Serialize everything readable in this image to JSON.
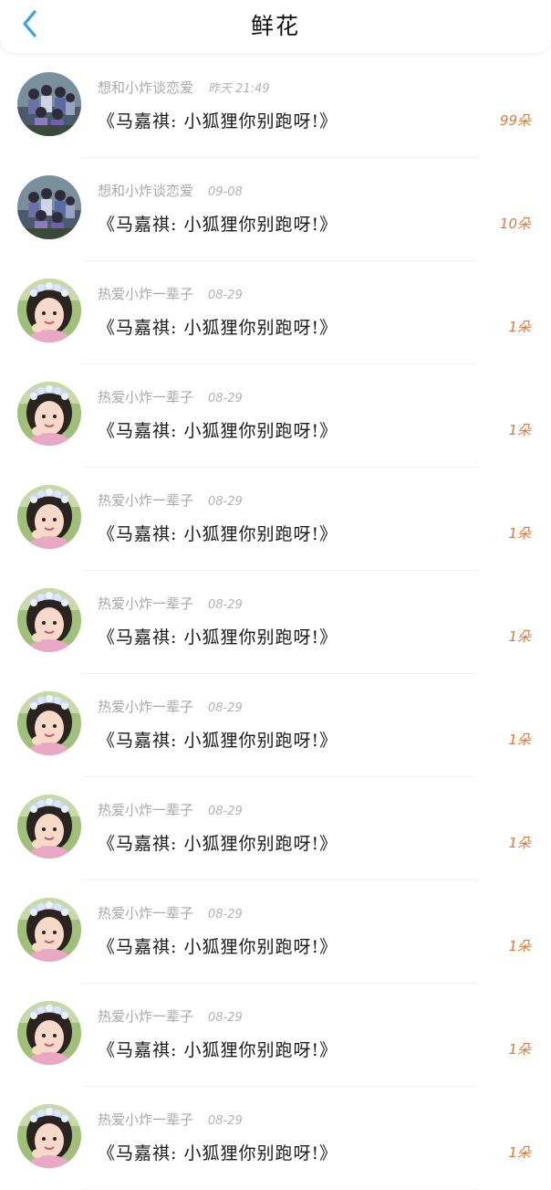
{
  "header": {
    "title": "鲜花",
    "back_icon": "chevron-left-icon",
    "accent_color": "#3aa0e8"
  },
  "colors": {
    "count": "#e07a3a",
    "meta": "#a9a9a9"
  },
  "rows": [
    {
      "username": "想和小炸谈恋爱",
      "time": "昨天 21:49",
      "message": "《马嘉祺: 小狐狸你别跑呀!》",
      "count": "99朵",
      "avatar": "group-photo-avatar"
    },
    {
      "username": "想和小炸谈恋爱",
      "time": "09-08",
      "message": "《马嘉祺: 小狐狸你别跑呀!》",
      "count": "10朵",
      "avatar": "group-photo-avatar"
    },
    {
      "username": "热爱小炸一辈子",
      "time": "08-29",
      "message": "《马嘉祺: 小狐狸你别跑呀!》",
      "count": "1朵",
      "avatar": "girl-portrait-avatar"
    },
    {
      "username": "热爱小炸一辈子",
      "time": "08-29",
      "message": "《马嘉祺: 小狐狸你别跑呀!》",
      "count": "1朵",
      "avatar": "girl-portrait-avatar"
    },
    {
      "username": "热爱小炸一辈子",
      "time": "08-29",
      "message": "《马嘉祺: 小狐狸你别跑呀!》",
      "count": "1朵",
      "avatar": "girl-portrait-avatar"
    },
    {
      "username": "热爱小炸一辈子",
      "time": "08-29",
      "message": "《马嘉祺: 小狐狸你别跑呀!》",
      "count": "1朵",
      "avatar": "girl-portrait-avatar"
    },
    {
      "username": "热爱小炸一辈子",
      "time": "08-29",
      "message": "《马嘉祺: 小狐狸你别跑呀!》",
      "count": "1朵",
      "avatar": "girl-portrait-avatar"
    },
    {
      "username": "热爱小炸一辈子",
      "time": "08-29",
      "message": "《马嘉祺: 小狐狸你别跑呀!》",
      "count": "1朵",
      "avatar": "girl-portrait-avatar"
    },
    {
      "username": "热爱小炸一辈子",
      "time": "08-29",
      "message": "《马嘉祺: 小狐狸你别跑呀!》",
      "count": "1朵",
      "avatar": "girl-portrait-avatar"
    },
    {
      "username": "热爱小炸一辈子",
      "time": "08-29",
      "message": "《马嘉祺: 小狐狸你别跑呀!》",
      "count": "1朵",
      "avatar": "girl-portrait-avatar"
    },
    {
      "username": "热爱小炸一辈子",
      "time": "08-29",
      "message": "《马嘉祺: 小狐狸你别跑呀!》",
      "count": "1朵",
      "avatar": "girl-portrait-avatar"
    }
  ]
}
